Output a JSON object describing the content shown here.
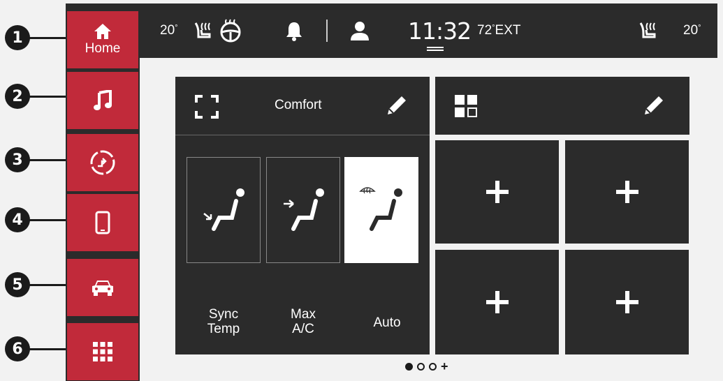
{
  "callouts": [
    "1",
    "2",
    "3",
    "4",
    "5",
    "6"
  ],
  "sidebar": {
    "items": [
      {
        "icon": "home-icon",
        "label": "Home"
      },
      {
        "icon": "music-note-icon",
        "label": ""
      },
      {
        "icon": "navigation-icon",
        "label": ""
      },
      {
        "icon": "phone-icon",
        "label": ""
      },
      {
        "icon": "car-icon",
        "label": ""
      },
      {
        "icon": "apps-grid-icon",
        "label": ""
      }
    ],
    "active_color": "#c12a3a"
  },
  "topbar": {
    "driver_temp": "20",
    "passenger_temp": "20",
    "degree": "°",
    "clock": "11:32",
    "exterior_temp": "72",
    "exterior_suffix": "EXT",
    "icons": [
      "heated-seat-icon",
      "heated-steering-wheel-icon",
      "bell-icon",
      "user-profile-icon",
      "passenger-heated-seat-icon"
    ]
  },
  "comfort": {
    "title": "Comfort",
    "modes": [
      {
        "label_line1": "Sync",
        "label_line2": "Temp",
        "active": false
      },
      {
        "label_line1": "Max",
        "label_line2": "A/C",
        "active": false
      },
      {
        "label_line1": "Auto",
        "label_line2": "",
        "active": true
      }
    ]
  },
  "widgets": {
    "add_tiles": 4
  },
  "pagination": {
    "pages": 3,
    "current": 0,
    "add_symbol": "+"
  }
}
